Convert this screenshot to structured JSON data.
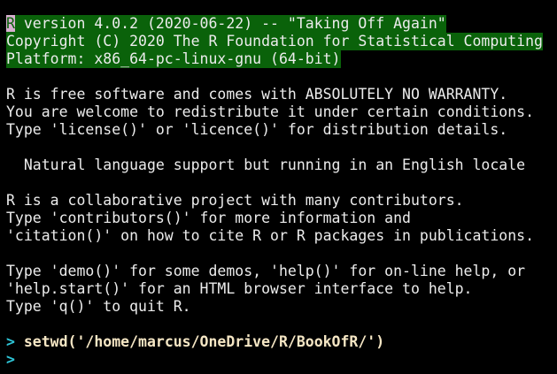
{
  "banner": [
    "R version 4.0.2 (2020-06-22) -- \"Taking Off Again\"",
    "Copyright (C) 2020 The R Foundation for Statistical Computing",
    "Platform: x86_64-pc-linux-gnu (64-bit)"
  ],
  "banner_first_char": "R",
  "banner_first_rest": " version 4.0.2 (2020-06-22) -- \"Taking Off Again\"",
  "warranty": [
    "R is free software and comes with ABSOLUTELY NO WARRANTY.",
    "You are welcome to redistribute it under certain conditions.",
    "Type 'license()' or 'licence()' for distribution details."
  ],
  "locale_note": "  Natural language support but running in an English locale",
  "collab": [
    "R is a collaborative project with many contributors.",
    "Type 'contributors()' for more information and",
    "'citation()' on how to cite R or R packages in publications."
  ],
  "help": [
    "Type 'demo()' for some demos, 'help()' for on-line help, or",
    "'help.start()' for an HTML browser interface to help.",
    "Type 'q()' to quit R."
  ],
  "prompt_symbol": ">",
  "command": "setwd('/home/marcus/OneDrive/R/BookOfR/')",
  "colors": {
    "highlight": "#0a620a",
    "prompt": "#2ec4d6",
    "command": "#f5e6c4",
    "background": "#000000"
  }
}
